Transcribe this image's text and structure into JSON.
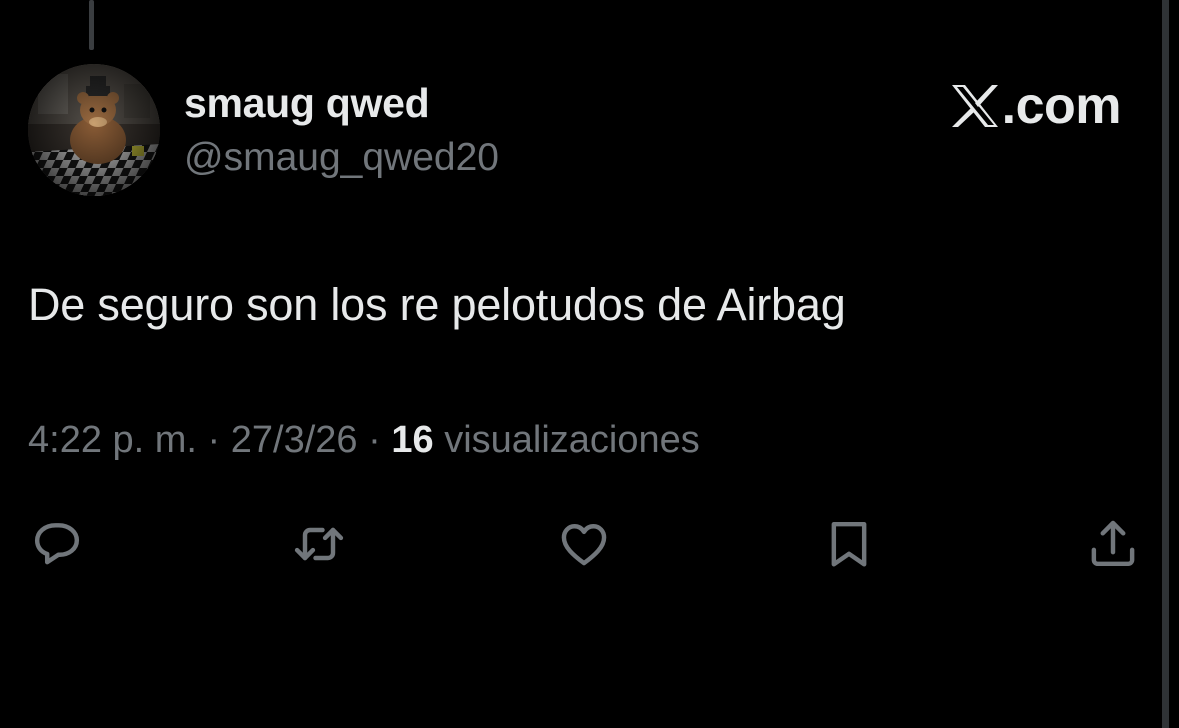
{
  "colors": {
    "background": "#000000",
    "primary_text": "#e7e9ea",
    "secondary_text": "#71767b",
    "icon": "#71767b"
  },
  "author": {
    "display_name": "smaug qwed",
    "handle": "@smaug_qwed20"
  },
  "brand": {
    "text": ".com",
    "icon": "x-logo-icon"
  },
  "tweet": {
    "text": "De seguro son los re pelotudos de Airbag"
  },
  "meta": {
    "time": "4:22 p. m.",
    "separator": "·",
    "date": "27/3/26",
    "views_count": "16",
    "views_label": "visualizaciones"
  },
  "actions": {
    "icons": [
      "reply-icon",
      "retweet-icon",
      "like-icon",
      "bookmark-icon",
      "share-icon"
    ]
  }
}
